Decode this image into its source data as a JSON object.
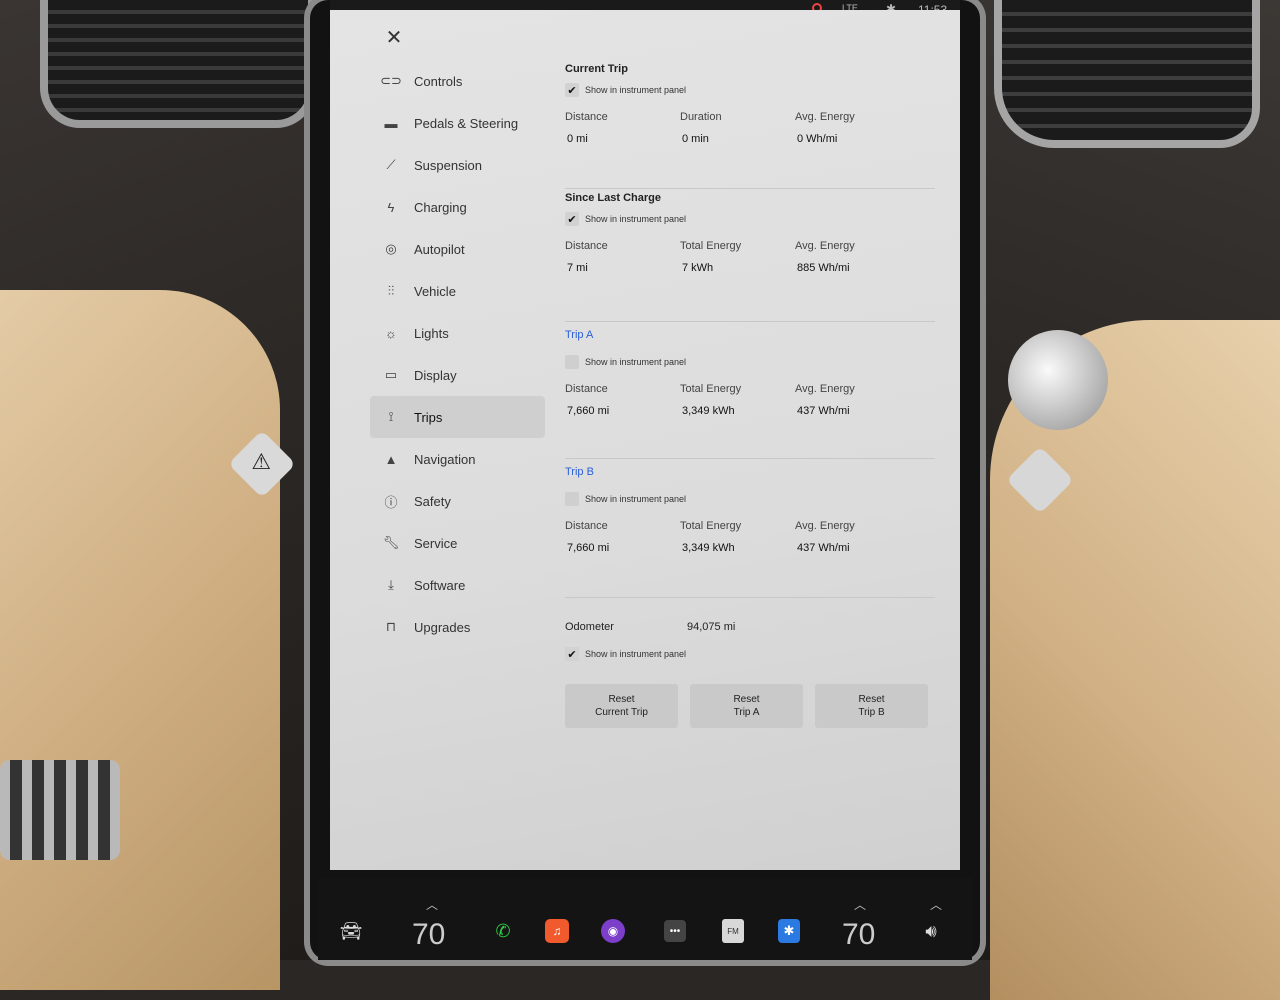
{
  "status": {
    "network": "LTE",
    "time": "11:53"
  },
  "close": {
    "icon": "✕"
  },
  "sidebar": {
    "items": [
      {
        "label": "Controls",
        "icon": "toggle-icon"
      },
      {
        "label": "Pedals & Steering",
        "icon": "car-icon"
      },
      {
        "label": "Suspension",
        "icon": "wrench-slash-icon"
      },
      {
        "label": "Charging",
        "icon": "lightning-icon"
      },
      {
        "label": "Autopilot",
        "icon": "steering-wheel-icon"
      },
      {
        "label": "Vehicle",
        "icon": "sliders-icon"
      },
      {
        "label": "Lights",
        "icon": "sun-icon"
      },
      {
        "label": "Display",
        "icon": "display-icon"
      },
      {
        "label": "Trips",
        "icon": "trips-icon",
        "active": true
      },
      {
        "label": "Navigation",
        "icon": "navigation-arrow-icon"
      },
      {
        "label": "Safety",
        "icon": "safety-icon"
      },
      {
        "label": "Service",
        "icon": "wrench-icon"
      },
      {
        "label": "Software",
        "icon": "download-icon"
      },
      {
        "label": "Upgrades",
        "icon": "bag-icon"
      }
    ]
  },
  "trips": {
    "show_label": "Show in instrument panel",
    "current": {
      "title": "Current Trip",
      "checked": true,
      "stats": [
        {
          "label": "Distance",
          "value": "0  mi"
        },
        {
          "label": "Duration",
          "value": "0  min"
        },
        {
          "label": "Avg. Energy",
          "value": "0  Wh/mi"
        }
      ]
    },
    "since_charge": {
      "title": "Since Last Charge",
      "checked": true,
      "stats": [
        {
          "label": "Distance",
          "value": "7  mi"
        },
        {
          "label": "Total Energy",
          "value": "7  kWh"
        },
        {
          "label": "Avg. Energy",
          "value": "885  Wh/mi"
        }
      ]
    },
    "trip_a": {
      "title": "Trip A",
      "checked": false,
      "stats": [
        {
          "label": "Distance",
          "value": "7,660  mi"
        },
        {
          "label": "Total Energy",
          "value": "3,349  kWh"
        },
        {
          "label": "Avg. Energy",
          "value": "437  Wh/mi"
        }
      ]
    },
    "trip_b": {
      "title": "Trip B",
      "checked": false,
      "stats": [
        {
          "label": "Distance",
          "value": "7,660  mi"
        },
        {
          "label": "Total Energy",
          "value": "3,349  kWh"
        },
        {
          "label": "Avg. Energy",
          "value": "437  Wh/mi"
        }
      ]
    },
    "odometer": {
      "label": "Odometer",
      "value": "94,075  mi",
      "checked": true
    }
  },
  "buttons": {
    "reset_current": {
      "line1": "Reset",
      "line2": "Current Trip"
    },
    "reset_a": {
      "line1": "Reset",
      "line2": "Trip A"
    },
    "reset_b": {
      "line1": "Reset",
      "line2": "Trip B"
    }
  },
  "dock": {
    "driver_temp": "70",
    "passenger_temp": "70",
    "fm_label": "FM"
  },
  "colors": {
    "link_blue": "#2a5fd6",
    "screen_bg": "#e0e0e0",
    "phone_green": "#2ecc40"
  }
}
